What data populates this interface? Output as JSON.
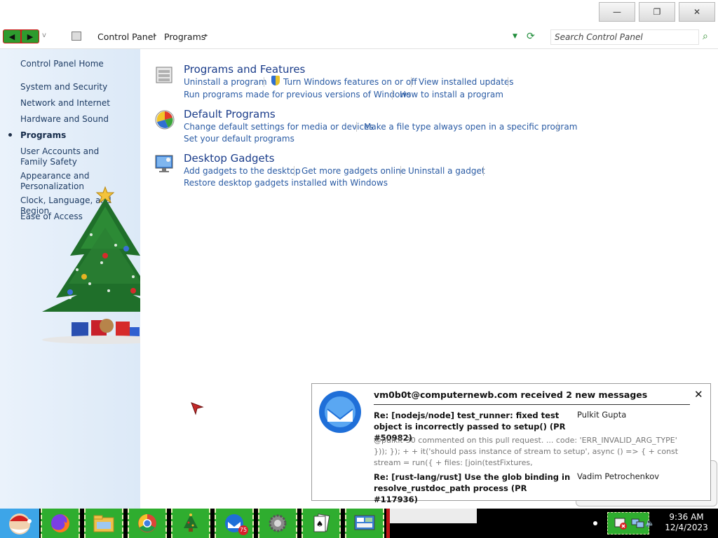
{
  "window": {
    "minimize_glyph": "—",
    "maximize_glyph": "❐",
    "close_glyph": "✕"
  },
  "address": {
    "back_icon": "back-arrow-icon",
    "forward_icon": "forward-arrow-icon",
    "recent_glyph": "v",
    "crumbs": [
      "Control Panel",
      "Programs"
    ],
    "search_placeholder": "Search Control Panel"
  },
  "sidebar": {
    "items": [
      {
        "label": "Control Panel Home"
      },
      {
        "label": "System and Security"
      },
      {
        "label": "Network and Internet"
      },
      {
        "label": "Hardware and Sound"
      },
      {
        "label": "Programs",
        "active": true
      },
      {
        "label": "User Accounts and Family Safety"
      },
      {
        "label": "Appearance and Personalization"
      },
      {
        "label": "Clock, Language, and Region"
      },
      {
        "label": "Ease of Access"
      }
    ]
  },
  "sections": [
    {
      "title": "Programs and Features",
      "icon": "programs-features-icon",
      "links": [
        "Uninstall a program",
        "Turn Windows features on or off",
        "View installed updates",
        "Run programs made for previous versions of Windows",
        "How to install a program"
      ]
    },
    {
      "title": "Default Programs",
      "icon": "default-programs-icon",
      "links": [
        "Change default settings for media or devices",
        "Make a file type always open in a specific program",
        "Set your default programs"
      ]
    },
    {
      "title": "Desktop Gadgets",
      "icon": "desktop-gadgets-icon",
      "links": [
        "Add gadgets to the desktop",
        "Get more gadgets online",
        "Uninstall a gadget",
        "Restore desktop gadgets installed with Windows"
      ]
    }
  ],
  "notification": {
    "header": "vm0b0t@computernewb.com received 2 new messages",
    "close_glyph": "✕",
    "messages": [
      {
        "subject": "Re: [nodejs/node] test_runner: fixed test object is incorrectly passed to setup() (PR #50982)",
        "author": "Pulkit Gupta",
        "preview": "@pulkit-30 commented on this pull request. ... code: 'ERR_INVALID_ARG_TYPE' })); }); + + it('should pass instance of stream to setup', async () => { + const stream = run({ + files: [join(testFixtures,"
      },
      {
        "subject": "Re: [rust-lang/rust] Use the glob binding in resolve_rustdoc_path process (PR #117936)",
        "author": "Vadim Petrochenkov"
      }
    ]
  },
  "taskbar": {
    "items": [
      "santa-start-icon",
      "firefox-icon",
      "file-explorer-icon",
      "chrome-icon",
      "christmas-tree-icon",
      "thunderbird-icon",
      "gear-icon",
      "solitaire-icon",
      "control-panel-icon"
    ],
    "thunderbird_badge": "75",
    "clock_time": "9:36 AM",
    "clock_date": "12/4/2023"
  },
  "colors": {
    "accent_green": "#2fad2f",
    "sidebar_bg": "#dce9f7",
    "link_blue": "#2a5ba4"
  }
}
